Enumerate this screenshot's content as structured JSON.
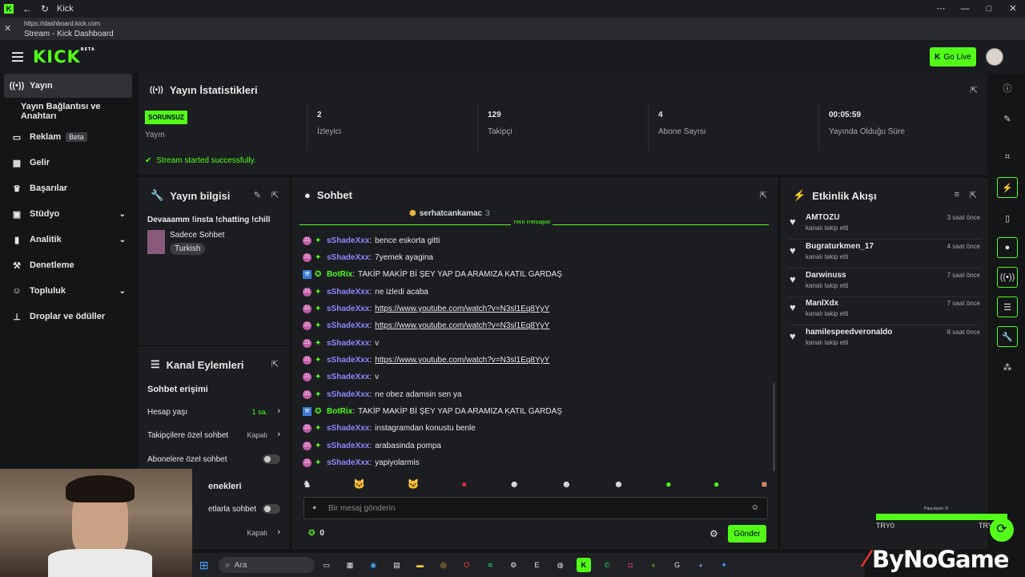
{
  "browser": {
    "title": "Kick",
    "url": "https://dashboard.kick.com",
    "tab_title": "Stream - Kick Dashboard"
  },
  "header": {
    "logo": "KICK",
    "logo_tag": "BETA",
    "go_live": "Go Live"
  },
  "sidebar": {
    "items": [
      {
        "label": "Yayın",
        "icon": "broadcast-icon"
      },
      {
        "label": "Yayın Bağlantısı ve Anahtarı",
        "icon": ""
      },
      {
        "label": "Reklam",
        "icon": "ad-icon",
        "badge": "Beta"
      },
      {
        "label": "Gelir",
        "icon": "revenue-icon"
      },
      {
        "label": "Başarılar",
        "icon": "trophy-icon"
      },
      {
        "label": "Stüdyo",
        "icon": "studio-icon"
      },
      {
        "label": "Analitik",
        "icon": "chart-icon"
      },
      {
        "label": "Denetleme",
        "icon": "hammer-icon"
      },
      {
        "label": "Topluluk",
        "icon": "people-icon"
      },
      {
        "label": "Droplar ve ödüller",
        "icon": "drops-icon"
      }
    ]
  },
  "stats": {
    "title": "Yayın İstatistikleri",
    "status_badge": "SORUNSUZ",
    "status_label": "Yayın",
    "cells": [
      {
        "value": "2",
        "label": "İzleyici"
      },
      {
        "value": "129",
        "label": "Takipçi"
      },
      {
        "value": "4",
        "label": "Abone Sayısı"
      },
      {
        "value": "00:05:59",
        "label": "Yayında Olduğu Süre"
      }
    ],
    "success": "Stream started successfully."
  },
  "info": {
    "title": "Yayın bilgisi",
    "stream_title": "Devaaamm !insta !chatting !chill",
    "category": "Sadece Sohbet",
    "language": "Turkish"
  },
  "actions": {
    "title": "Kanal Eylemleri",
    "section": "Sohbet erişimi",
    "rows": [
      {
        "label": "Hesap yaşı",
        "value": "1 sa."
      },
      {
        "label": "Takipçilere özel sohbet",
        "value": "Kapalı"
      },
      {
        "label": "Abonelere özel sohbet",
        "value": ""
      }
    ],
    "section2": "enekleri",
    "row4": "etlarla sohbet",
    "row5_value": "Kapalı"
  },
  "chat": {
    "title": "Sohbet",
    "pinned_user": "serhatcankamac",
    "pinned_count": "3",
    "new_messages": "Yeni mesajlar",
    "messages": [
      {
        "user": "sShadeXxx",
        "text": "bence eskorta gitti",
        "link": false,
        "bot": false
      },
      {
        "user": "sShadeXxx",
        "text": "7yemek ayagina",
        "link": false,
        "bot": false
      },
      {
        "user": "BotRix",
        "text": "TAKİP MAKİP Bİ ŞEY YAP DA ARAMIZA KATIL GARDAŞ",
        "link": false,
        "bot": true
      },
      {
        "user": "sShadeXxx",
        "text": "ne izledi acaba",
        "link": false,
        "bot": false
      },
      {
        "user": "sShadeXxx",
        "text": "https://www.youtube.com/watch?v=N3sl1Eq8YyY",
        "link": true,
        "bot": false
      },
      {
        "user": "sShadeXxx",
        "text": "https://www.youtube.com/watch?v=N3sl1Eq8YyY",
        "link": true,
        "bot": false
      },
      {
        "user": "sShadeXxx",
        "text": "v",
        "link": false,
        "bot": false
      },
      {
        "user": "sShadeXxx",
        "text": "https://www.youtube.com/watch?v=N3sl1Eq8YyY",
        "link": true,
        "bot": false
      },
      {
        "user": "sShadeXxx",
        "text": "v",
        "link": false,
        "bot": false
      },
      {
        "user": "sShadeXxx",
        "text": "ne obez adamsin sen ya",
        "link": false,
        "bot": false
      },
      {
        "user": "BotRix",
        "text": "TAKİP MAKİP Bİ ŞEY YAP DA ARAMIZA KATIL GARDAŞ",
        "link": false,
        "bot": true
      },
      {
        "user": "sShadeXxx",
        "text": "instagramdan konustu benle",
        "link": false,
        "bot": false
      },
      {
        "user": "sShadeXxx",
        "text": "arabasinda pompa",
        "link": false,
        "bot": false
      },
      {
        "user": "sShadeXxx",
        "text": "yapiyolarmis",
        "link": false,
        "bot": false
      }
    ],
    "placeholder": "Bir mesaj gönderin",
    "points": "0",
    "send": "Gönder"
  },
  "feed": {
    "title": "Etkinlik Akışı",
    "items": [
      {
        "name": "AMTOZU",
        "sub": "kanalı takip etti",
        "time": "3 saat önce"
      },
      {
        "name": "Bugraturkmen_17",
        "sub": "kanalı takip etti",
        "time": "4 saat önce"
      },
      {
        "name": "Darwinuss",
        "sub": "kanalı takip etti",
        "time": "7 saat önce"
      },
      {
        "name": "ManlXdx",
        "sub": "kanalı takip etti",
        "time": "7 saat önce"
      },
      {
        "name": "hamilespeedveronaldo",
        "sub": "kanalı takip etti",
        "time": "8 saat önce"
      }
    ]
  },
  "overlay": {
    "label": "Para lazım :D",
    "left": "TRY0",
    "right": "TRY0",
    "brand": "ByNoGame"
  },
  "taskbar": {
    "search": "Ara"
  },
  "colors": {
    "accent": "#53fc18",
    "username": "#8f87ff",
    "panel": "#1b1d21"
  }
}
